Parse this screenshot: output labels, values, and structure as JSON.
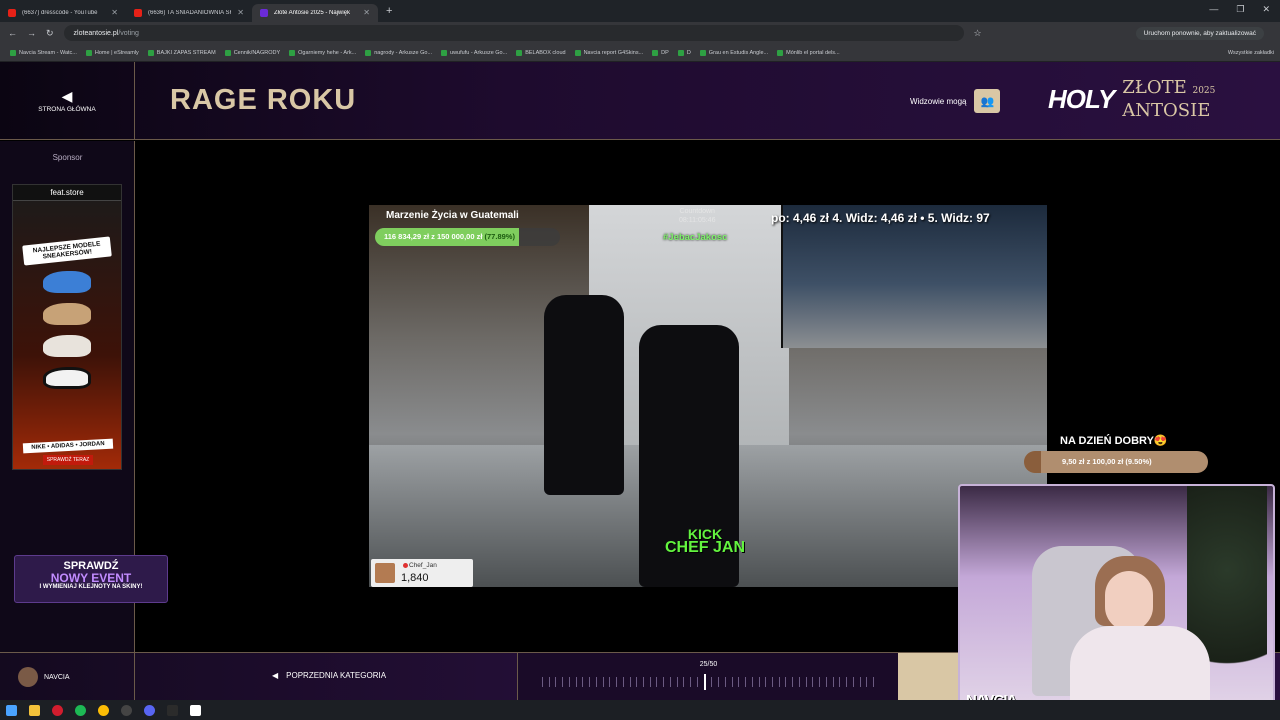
{
  "browser": {
    "tabs": [
      {
        "title": "(6637) dresscode - YouTube",
        "active": false
      },
      {
        "title": "(6636) TA ŚNIADANIOWNIA SKRA",
        "active": false
      },
      {
        "title": "Złote Antosie 2025 - Najwięk",
        "active": true
      }
    ],
    "url_domain": "zloteantosie.pl",
    "url_path": "/voting",
    "update_label": "Uruchom ponownie, aby zaktualizować",
    "bookmarks": [
      "Navcia Stream - Watc...",
      "Home | eStreamly",
      "BAJKI ZAPAS STREAM",
      "Cennik/NAGRODY",
      "Ogarniemy hehe - Ark...",
      "nagrody - Arkusze Go...",
      "uwufufu - Arkusze Go...",
      "BELABOX cloud",
      "Navcia report G4Skins...",
      "DP",
      "D",
      "Grau en Estudis Angle...",
      "Mónlib el portal dels..."
    ],
    "bookmarks_all": "Wszystkie zakładki"
  },
  "header": {
    "home_label": "STRONA GŁÓWNA",
    "category_title": "RAGE ROKU",
    "viewers_label": "Widzowie mogą",
    "logo_holy": "HOLY",
    "logo_zlote": "ZŁOTE",
    "logo_antosie": "ANTOSIE",
    "logo_year": "2025"
  },
  "sidebar": {
    "sponsor_label": "Sponsor",
    "ad_brand": "feat.store",
    "ad_headline": "NAJLEPSZE MODELE SNEAKERSÓW!",
    "ad_brands": "NIKE • ADIDAS • JORDAN",
    "ad_cta": "SPRAWDŹ TERAZ",
    "event_line1": "SPRAWDŹ",
    "event_line2": "NOWY EVENT",
    "event_line3": "I WYMIENIAJ KLEJNOTY NA SKINY!"
  },
  "video": {
    "goal_title": "Marzenie Życia w Guatemali",
    "goal_amount": "116 834,29 zł z 150 000,00 zł",
    "goal_pct": "(77.89%)",
    "goal_fraction": 0.7789,
    "countdown_label": "Countdown",
    "countdown_value": "08:11:05:46",
    "hashtag": "#JebacJakosc",
    "ranks_text": "po: 4,46 zł   4. Widz: 4,46 zł   • 5. Widz: 97",
    "kick_line1": "KICK",
    "kick_line2": "CHEF JAN",
    "channel_name": "Chef_Jan",
    "channel_count": "1,840"
  },
  "stream_overlay": {
    "goal_title": "NA DZIEŃ DOBRY😍",
    "goal_text": "9,50 zł z 100,00 zł (9.50%)",
    "goal_fraction": 0.095,
    "cam_name": "NAVCIA"
  },
  "footer": {
    "user_name": "NAVCIA",
    "prev_label": "POPRZEDNIA KATEGORIA",
    "progress_label": "25/50",
    "progress_current": 25,
    "progress_total": 50
  }
}
